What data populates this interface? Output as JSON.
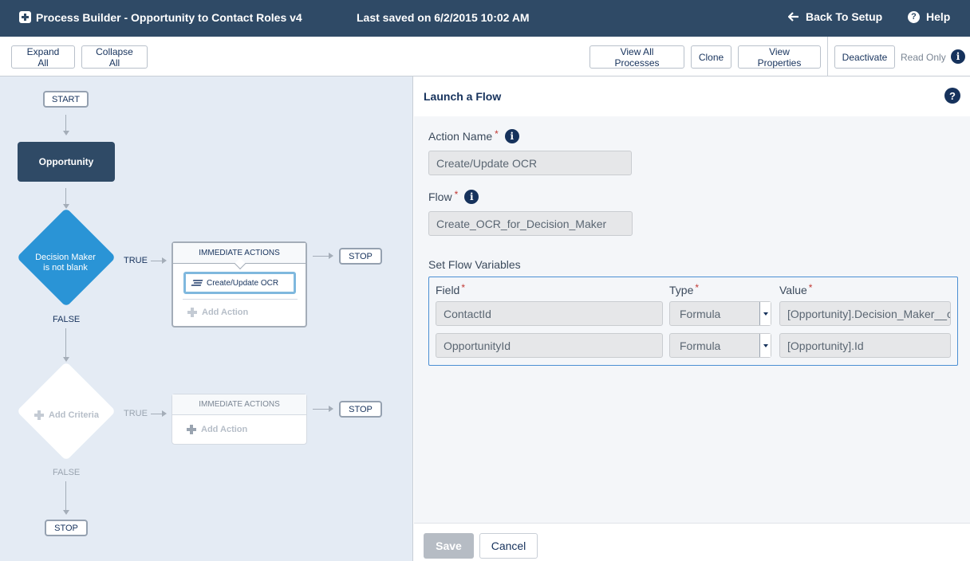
{
  "header": {
    "title": "Process Builder - Opportunity to Contact Roles v4",
    "saved": "Last saved on 6/2/2015 10:02 AM",
    "back_label": "Back To Setup",
    "help_label": "Help"
  },
  "toolbar": {
    "expand_all": "Expand All",
    "collapse_all": "Collapse All",
    "view_all_processes": "View All Processes",
    "clone": "Clone",
    "view_properties": "View Properties",
    "deactivate": "Deactivate",
    "read_only": "Read Only"
  },
  "canvas": {
    "start": "START",
    "object": "Opportunity",
    "criteria_1": {
      "line1": "Decision Maker",
      "line2": "is not blank",
      "true_label": "TRUE",
      "false_label": "FALSE"
    },
    "immediate_1": {
      "header": "IMMEDIATE ACTIONS",
      "action": "Create/Update OCR",
      "add": "Add Action"
    },
    "stop_1": "STOP",
    "criteria_2": {
      "label": "Add Criteria",
      "true_label": "TRUE",
      "false_label": "FALSE"
    },
    "immediate_2": {
      "header": "IMMEDIATE ACTIONS",
      "add": "Add Action"
    },
    "stop_2": "STOP",
    "stop_3": "STOP"
  },
  "panel": {
    "title": "Launch a Flow",
    "action_name_label": "Action Name",
    "action_name_value": "Create/Update OCR",
    "flow_label": "Flow",
    "flow_value": "Create_OCR_for_Decision_Maker",
    "set_vars_label": "Set Flow Variables",
    "columns": {
      "field": "Field",
      "type": "Type",
      "value": "Value"
    },
    "rows": [
      {
        "field": "ContactId",
        "type": "Formula",
        "value": "[Opportunity].Decision_Maker__c"
      },
      {
        "field": "OpportunityId",
        "type": "Formula",
        "value": "[Opportunity].Id"
      }
    ],
    "save": "Save",
    "cancel": "Cancel"
  },
  "colors": {
    "header_bg": "#2f4a66",
    "accent": "#2a94d6",
    "canvas_bg": "#e4ebf4"
  }
}
